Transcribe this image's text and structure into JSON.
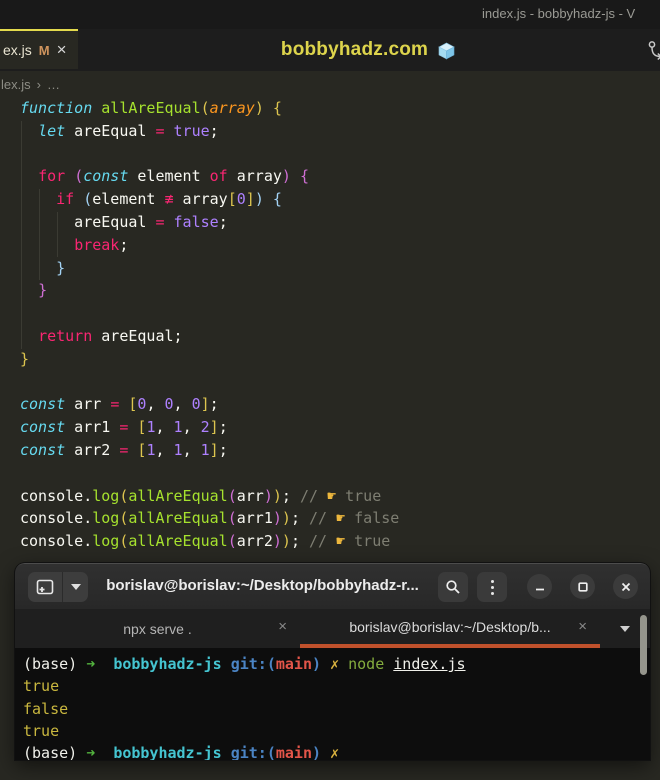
{
  "palette": {
    "editor_bg": "#272822",
    "titlebar_bg": "#191919",
    "tabstrip_bg": "#1d1d1d",
    "active_tab_border": "#e3da4d",
    "banner_yellow": "#ddd44c",
    "keyword_pink": "#f92672",
    "storage_cyan": "#66d9ef",
    "function_green": "#a6e22e",
    "param_orange": "#fd971f",
    "constant_purple": "#ae81ff",
    "comment_grey": "#7e7e72",
    "bracket_gold": "#ddc54f",
    "bracket_orchid": "#cf6fd4",
    "bracket_blue": "#a3d3f5",
    "terminal_bg": "#0d0d0d",
    "terminal_tab_underline": "#c0512c",
    "prompt_cyan": "#45c5d1",
    "prompt_blue": "#4b84c4",
    "prompt_red": "#e35549",
    "prompt_green": "#53b33e",
    "output_yellow": "#c9b73f"
  },
  "vscode": {
    "window_title": "index.js - bobbyhadz-js - V",
    "tab": {
      "label": "ex.js",
      "modified": "M",
      "close": "×"
    },
    "banner": {
      "text": "bobbyhadz.com",
      "icon": "ice-cube"
    },
    "breadcrumb": {
      "file": "lex.js",
      "separator": "›",
      "ellipsis": "…"
    },
    "code_lines": [
      [
        [
          "s",
          "function"
        ],
        [
          "w",
          " "
        ],
        [
          "f",
          "allAreEqual"
        ],
        [
          "b1",
          "("
        ],
        [
          "p",
          "array"
        ],
        [
          "b1",
          ")"
        ],
        [
          "w",
          " "
        ],
        [
          "b1",
          "{"
        ]
      ],
      [
        [
          "w",
          "  "
        ],
        [
          "s",
          "let"
        ],
        [
          "w",
          " areEqual "
        ],
        [
          "o",
          "="
        ],
        [
          "w",
          " "
        ],
        [
          "n",
          "true"
        ],
        [
          "w",
          ";"
        ]
      ],
      [],
      [
        [
          "w",
          "  "
        ],
        [
          "k",
          "for"
        ],
        [
          "w",
          " "
        ],
        [
          "b2",
          "("
        ],
        [
          "s",
          "const"
        ],
        [
          "w",
          " element "
        ],
        [
          "k",
          "of"
        ],
        [
          "w",
          " array"
        ],
        [
          "b2",
          ")"
        ],
        [
          "w",
          " "
        ],
        [
          "b2",
          "{"
        ]
      ],
      [
        [
          "w",
          "    "
        ],
        [
          "k",
          "if"
        ],
        [
          "w",
          " "
        ],
        [
          "b3",
          "("
        ],
        [
          "w",
          "element "
        ],
        [
          "o",
          "≢"
        ],
        [
          "w",
          " array"
        ],
        [
          "b1",
          "["
        ],
        [
          "n",
          "0"
        ],
        [
          "b1",
          "]"
        ],
        [
          "b3",
          ")"
        ],
        [
          "w",
          " "
        ],
        [
          "b3",
          "{"
        ]
      ],
      [
        [
          "w",
          "      areEqual "
        ],
        [
          "o",
          "="
        ],
        [
          "w",
          " "
        ],
        [
          "n",
          "false"
        ],
        [
          "w",
          ";"
        ]
      ],
      [
        [
          "w",
          "      "
        ],
        [
          "k",
          "break"
        ],
        [
          "w",
          ";"
        ]
      ],
      [
        [
          "w",
          "    "
        ],
        [
          "b3",
          "}"
        ]
      ],
      [
        [
          "w",
          "  "
        ],
        [
          "b2",
          "}"
        ]
      ],
      [],
      [
        [
          "w",
          "  "
        ],
        [
          "k",
          "return"
        ],
        [
          "w",
          " areEqual;"
        ]
      ],
      [
        [
          "b1",
          "}"
        ]
      ],
      [],
      [
        [
          "s",
          "const"
        ],
        [
          "w",
          " arr "
        ],
        [
          "o",
          "="
        ],
        [
          "w",
          " "
        ],
        [
          "b1",
          "["
        ],
        [
          "n",
          "0"
        ],
        [
          "w",
          ", "
        ],
        [
          "n",
          "0"
        ],
        [
          "w",
          ", "
        ],
        [
          "n",
          "0"
        ],
        [
          "b1",
          "]"
        ],
        [
          "w",
          ";"
        ]
      ],
      [
        [
          "s",
          "const"
        ],
        [
          "w",
          " arr1 "
        ],
        [
          "o",
          "="
        ],
        [
          "w",
          " "
        ],
        [
          "b1",
          "["
        ],
        [
          "n",
          "1"
        ],
        [
          "w",
          ", "
        ],
        [
          "n",
          "1"
        ],
        [
          "w",
          ", "
        ],
        [
          "n",
          "2"
        ],
        [
          "b1",
          "]"
        ],
        [
          "w",
          ";"
        ]
      ],
      [
        [
          "s",
          "const"
        ],
        [
          "w",
          " arr2 "
        ],
        [
          "o",
          "="
        ],
        [
          "w",
          " "
        ],
        [
          "b1",
          "["
        ],
        [
          "n",
          "1"
        ],
        [
          "w",
          ", "
        ],
        [
          "n",
          "1"
        ],
        [
          "w",
          ", "
        ],
        [
          "n",
          "1"
        ],
        [
          "b1",
          "]"
        ],
        [
          "w",
          ";"
        ]
      ],
      [],
      [
        [
          "w",
          "console."
        ],
        [
          "f",
          "log"
        ],
        [
          "b1",
          "("
        ],
        [
          "f",
          "allAreEqual"
        ],
        [
          "b2",
          "("
        ],
        [
          "w",
          "arr"
        ],
        [
          "b2",
          ")"
        ],
        [
          "b1",
          ")"
        ],
        [
          "w",
          "; "
        ],
        [
          "c",
          "// "
        ],
        [
          "e",
          "☛"
        ],
        [
          "c",
          " true"
        ]
      ],
      [
        [
          "w",
          "console."
        ],
        [
          "f",
          "log"
        ],
        [
          "b1",
          "("
        ],
        [
          "f",
          "allAreEqual"
        ],
        [
          "b2",
          "("
        ],
        [
          "w",
          "arr1"
        ],
        [
          "b2",
          ")"
        ],
        [
          "b1",
          ")"
        ],
        [
          "w",
          "; "
        ],
        [
          "c",
          "// "
        ],
        [
          "e",
          "☛"
        ],
        [
          "c",
          " false"
        ]
      ],
      [
        [
          "w",
          "console."
        ],
        [
          "f",
          "log"
        ],
        [
          "b1",
          "("
        ],
        [
          "f",
          "allAreEqual"
        ],
        [
          "b2",
          "("
        ],
        [
          "w",
          "arr2"
        ],
        [
          "b2",
          ")"
        ],
        [
          "b1",
          ")"
        ],
        [
          "w",
          "; "
        ],
        [
          "c",
          "// "
        ],
        [
          "e",
          "☛"
        ],
        [
          "c",
          " true"
        ]
      ]
    ]
  },
  "terminal": {
    "title": "borislav@borislav:~/Desktop/bobbyhadz-r...",
    "tabs": [
      {
        "label": "npx serve .",
        "close": "×"
      },
      {
        "label": "borislav@borislav:~/Desktop/b...",
        "close": "×"
      }
    ],
    "lines": [
      [
        [
          "wt",
          "(base) "
        ],
        [
          "gr",
          "➜"
        ],
        [
          "wt",
          "  "
        ],
        [
          "cy",
          "bobbyhadz-js"
        ],
        [
          "wt",
          " "
        ],
        [
          "bl",
          "git:("
        ],
        [
          "rd",
          "main"
        ],
        [
          "bl",
          ")"
        ],
        [
          "wt",
          " "
        ],
        [
          "yl",
          "✗"
        ],
        [
          "wt",
          " "
        ],
        [
          "ng",
          "node"
        ],
        [
          "wt",
          " "
        ],
        [
          "un",
          "index.js"
        ]
      ],
      [
        [
          "ye",
          "true"
        ]
      ],
      [
        [
          "ye",
          "false"
        ]
      ],
      [
        [
          "ye",
          "true"
        ]
      ],
      [
        [
          "wt",
          "(base) "
        ],
        [
          "gr",
          "➜"
        ],
        [
          "wt",
          "  "
        ],
        [
          "cy",
          "bobbyhadz-js"
        ],
        [
          "wt",
          " "
        ],
        [
          "bl",
          "git:("
        ],
        [
          "rd",
          "main"
        ],
        [
          "bl",
          ")"
        ],
        [
          "wt",
          " "
        ],
        [
          "yl",
          "✗"
        ]
      ]
    ]
  }
}
